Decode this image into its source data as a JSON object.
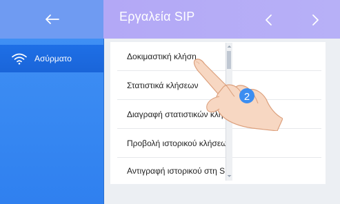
{
  "header": {
    "title": "Εργαλεία SIP"
  },
  "sidebar": {
    "items": [
      {
        "label": "Ασύρματο",
        "icon": "wifi-icon"
      }
    ]
  },
  "menu": {
    "items": [
      {
        "label": "Δοκιμαστική κλήση"
      },
      {
        "label": "Στατιστικά κλήσεων"
      },
      {
        "label": "Διαγραφή στατιστικών κλήσεων"
      },
      {
        "label": "Προβολή ιστορικού κλήσεων"
      },
      {
        "label": "Αντιγραφή ιστορικού στη SD"
      }
    ]
  },
  "callout": {
    "step": "2"
  },
  "colors": {
    "sidebar": "#3f8ff4",
    "sidebar_selected": "#1e6fe6",
    "header_left": "#6f9bf2",
    "header_right": "#b3a8f6",
    "step_badge": "#3b8df1"
  }
}
